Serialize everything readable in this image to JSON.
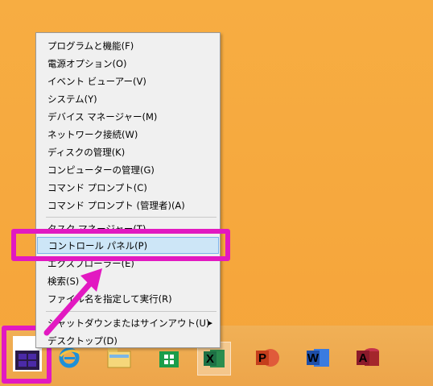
{
  "menu": {
    "items": [
      {
        "label": "プログラムと機能(F)"
      },
      {
        "label": "電源オプション(O)"
      },
      {
        "label": "イベント ビューアー(V)"
      },
      {
        "label": "システム(Y)"
      },
      {
        "label": "デバイス マネージャー(M)"
      },
      {
        "label": "ネットワーク接続(W)"
      },
      {
        "label": "ディスクの管理(K)"
      },
      {
        "label": "コンピューターの管理(G)"
      },
      {
        "label": "コマンド プロンプト(C)"
      },
      {
        "label": "コマンド プロンプト (管理者)(A)"
      },
      {
        "label": "タスク マネージャー(T)"
      },
      {
        "label": "コントロール パネル(P)",
        "highlighted": true
      },
      {
        "label": "エクスプローラー(E)"
      },
      {
        "label": "検索(S)"
      },
      {
        "label": "ファイル名を指定して実行(R)"
      },
      {
        "label": "シャットダウンまたはサインアウト(U)",
        "submenu": true
      },
      {
        "label": "デスクトップ(D)"
      }
    ]
  },
  "taskbar": {
    "apps": [
      {
        "name": "internet-explorer-icon"
      },
      {
        "name": "file-explorer-icon"
      },
      {
        "name": "store-icon"
      },
      {
        "name": "excel-icon",
        "active": true,
        "letter": "X"
      },
      {
        "name": "powerpoint-icon",
        "letter": "P"
      },
      {
        "name": "word-icon",
        "letter": "W"
      },
      {
        "name": "access-icon",
        "letter": "A"
      }
    ]
  },
  "colors": {
    "annotation": "#e219c1",
    "desktop": "#f6a93c",
    "highlight": "#cde6f7"
  }
}
